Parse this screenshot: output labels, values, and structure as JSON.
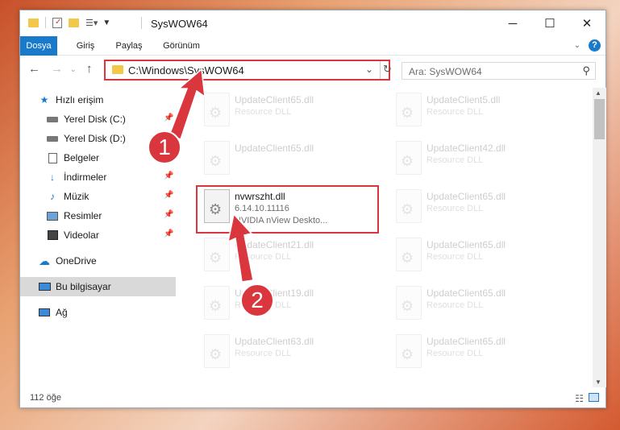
{
  "window": {
    "title": "SysWOW64",
    "controls": {
      "minimize": "─",
      "maximize": "☐",
      "close": "✕"
    }
  },
  "ribbon": {
    "tabs": [
      {
        "label": "Dosya",
        "active": true
      },
      {
        "label": "Giriş"
      },
      {
        "label": "Paylaş"
      },
      {
        "label": "Görünüm"
      }
    ]
  },
  "nav": {
    "address": "C:\\Windows\\SysWOW64",
    "search_placeholder": "Ara: SysWOW64"
  },
  "sidebar": {
    "items": [
      {
        "label": "Hızlı erişim",
        "icon": "star-icon"
      },
      {
        "label": "Yerel Disk (C:)",
        "icon": "drive-icon",
        "pinned": true
      },
      {
        "label": "Yerel Disk (D:)",
        "icon": "drive-icon"
      },
      {
        "label": "Belgeler",
        "icon": "documents-icon",
        "pinned": true
      },
      {
        "label": "İndirmeler",
        "icon": "download-icon",
        "pinned": true
      },
      {
        "label": "Müzik",
        "icon": "music-icon",
        "pinned": true
      },
      {
        "label": "Resimler",
        "icon": "pictures-icon",
        "pinned": true
      },
      {
        "label": "Videolar",
        "icon": "videos-icon",
        "pinned": true
      },
      {
        "label": "OneDrive",
        "icon": "cloud-icon"
      },
      {
        "label": "Bu bilgisayar",
        "icon": "computer-icon",
        "selected": true
      },
      {
        "label": "Ağ",
        "icon": "network-icon"
      }
    ]
  },
  "files": {
    "left": [
      {
        "name": "UpdateClient65.dll",
        "type": "Resource DLL"
      },
      {
        "name": "UpdateClient65.dll",
        "type": ""
      },
      {
        "name": "nvwrszht.dll",
        "version": "6.14.10.11116",
        "desc": "NVIDIA nView Deskto..."
      },
      {
        "name": "UpdateClient21.dll",
        "type": "Resource DLL"
      },
      {
        "name": "UpdateClient19.dll",
        "type": "Resource DLL"
      },
      {
        "name": "UpdateClient63.dll",
        "type": "Resource DLL"
      }
    ],
    "right": [
      {
        "name": "UpdateClient5.dll",
        "type": "Resource DLL"
      },
      {
        "name": "UpdateClient42.dll",
        "type": "Resource DLL"
      },
      {
        "name": "UpdateClient65.dll",
        "type": "Resource DLL"
      },
      {
        "name": "UpdateClient65.dll",
        "type": "Resource DLL"
      },
      {
        "name": "UpdateClient65.dll",
        "type": "Resource DLL"
      },
      {
        "name": "UpdateClient65.dll",
        "type": "Resource DLL"
      }
    ]
  },
  "status": {
    "item_count": "112 öğe"
  },
  "callouts": {
    "one": "1",
    "two": "2"
  },
  "colors": {
    "accent": "#1979ca",
    "callout": "#d9363e",
    "selected": "#d9d9d9"
  }
}
